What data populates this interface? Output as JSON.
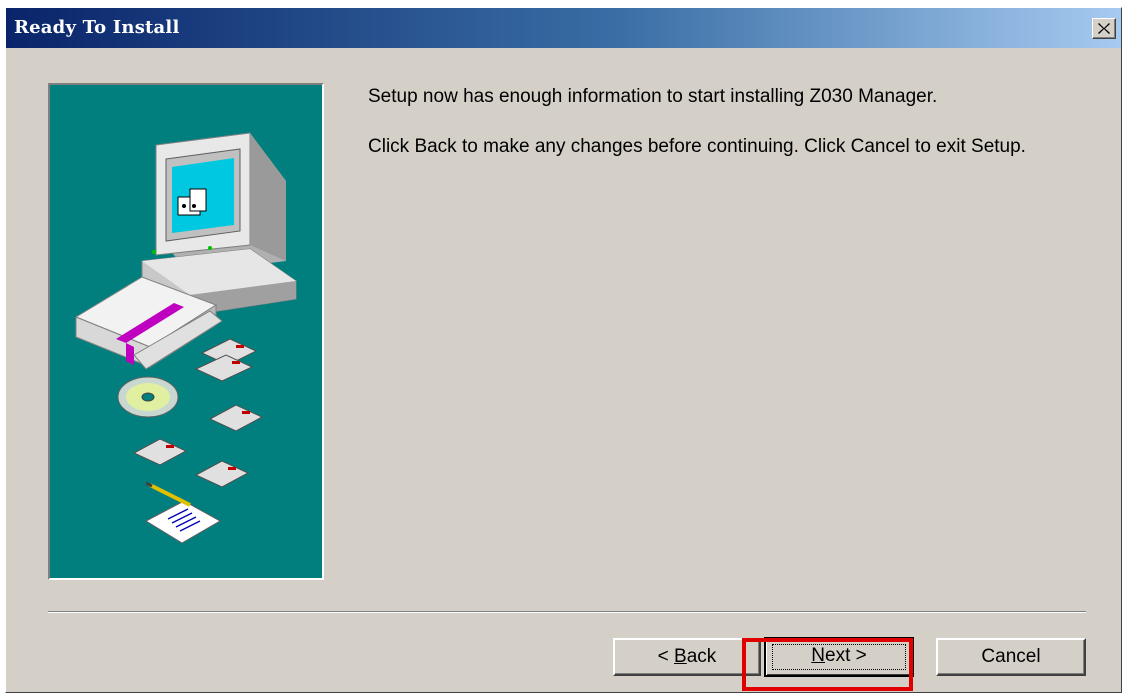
{
  "window": {
    "title": "Ready To Install",
    "close_glyph": "✕"
  },
  "main": {
    "message_line1": "Setup now has enough information to start installing Z030 Manager.",
    "message_line2": "Click Back to make any changes before continuing. Click Cancel to exit Setup."
  },
  "buttons": {
    "back": {
      "prefix": "< ",
      "accel": "B",
      "rest": "ack"
    },
    "next": {
      "accel": "N",
      "rest": "ext >"
    },
    "cancel": "Cancel"
  },
  "colors": {
    "title_gradient_start": "#0a246a",
    "title_gradient_end": "#a6caf0",
    "dialog_bg": "#d4d0c8",
    "art_bg": "#007f7e",
    "highlight": "#e00000"
  },
  "icons": [
    "computer-icon",
    "software-box-icon",
    "floppy-disk-icon",
    "cd-icon",
    "notepad-pencil-icon"
  ]
}
